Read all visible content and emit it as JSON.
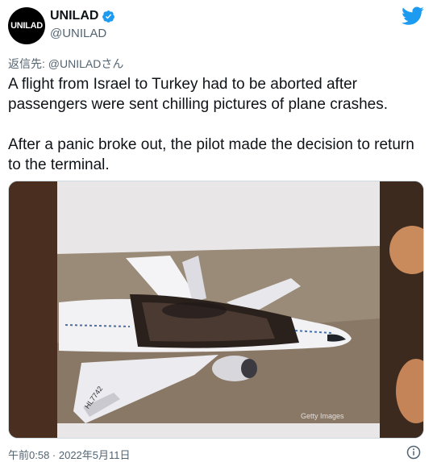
{
  "author": {
    "display_name": "UNILAD",
    "handle": "@UNILAD",
    "avatar_text": "UNILAD",
    "verified": true
  },
  "reply": {
    "prefix": "返信先: ",
    "target": "@UNILADさん"
  },
  "tweet": {
    "text": "A flight from Israel to Turkey had to be aborted after passengers were sent chilling pictures of plane crashes.\n\nAfter a panic broke out, the pilot made the decision to return to the terminal."
  },
  "media": {
    "watermark": "Getty Images",
    "tail_number": "HL7742"
  },
  "meta": {
    "timestamp": "午前0:58 · 2022年5月11日"
  },
  "icons": {
    "verified": "verified-badge-icon",
    "twitter": "twitter-bird-icon",
    "info": "info-icon"
  },
  "colors": {
    "accent": "#1d9bf0",
    "text": "#0f1419",
    "secondary": "#536471"
  }
}
